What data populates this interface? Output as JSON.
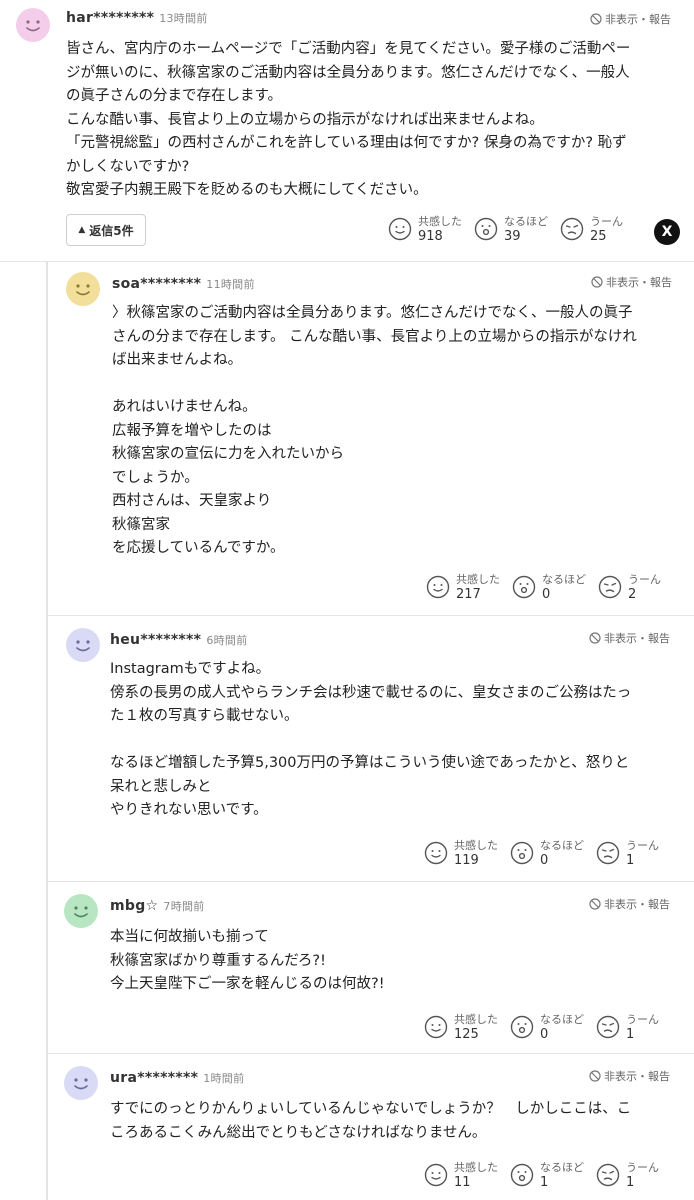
{
  "report_label": "非表示・報告",
  "reaction_labels": {
    "agree": "共感した",
    "understood": "なるほど",
    "hmm": "うーん"
  },
  "colors": {
    "avatar_pink": "#f4cdea",
    "avatar_yellow": "#f2df9a",
    "avatar_lavender": "#d9daf5",
    "avatar_green": "#b8e6c2"
  },
  "top_comment": {
    "author": "har********",
    "time": "13時間前",
    "body": "皆さん、宮内庁のホームページで「ご活動内容」を見てください。愛子様のご活動ペー\nジが無いのに、秋篠宮家のご活動内容は全員分あります。悠仁さんだけでなく、一般人\nの眞子さんの分まで存在します。\nこんな酷い事、長官より上の立場からの指示がなければ出来ませんよね。\n「元警視総監」の西村さんがこれを許している理由は何ですか? 保身の為ですか? 恥ず\nかしくないですか?\n敬宮愛子内親王殿下を貶めるのも大概にしてください。",
    "reply_button": "返信5件",
    "agree": "918",
    "understood": "39",
    "hmm": "25",
    "share_label": "X"
  },
  "replies": [
    {
      "author": "soa********",
      "time": "11時間前",
      "body": "〉秋篠宮家のご活動内容は全員分あります。悠仁さんだけでなく、一般人の眞子\nさんの分まで存在します。 こんな酷い事、長官より上の立場からの指示がなけれ\nば出来ませんよね。\n\nあれはいけませんね。\n広報予算を増やしたのは\n秋篠宮家の宣伝に力を入れたいから\nでしょうか。\n西村さんは、天皇家より\n秋篠宮家\nを応援しているんですか。",
      "agree": "217",
      "understood": "0",
      "hmm": "2"
    },
    {
      "author": "heu********",
      "time": "6時間前",
      "body": "Instagramもですよね。\n傍系の長男の成人式やらランチ会は秒速で載せるのに、皇女さまのご公務はたっ\nた１枚の写真すら載せない。\n\nなるほど増額した予算5,300万円の予算はこういう使い途であったかと、怒りと\n呆れと悲しみと\nやりきれない思いです。",
      "agree": "119",
      "understood": "0",
      "hmm": "1"
    },
    {
      "author": "mbg☆",
      "time": "7時間前",
      "body": "本当に何故揃いも揃って\n秋篠宮家ばかり尊重するんだろ?!\n今上天皇陛下ご一家を軽んじるのは何故?!",
      "agree": "125",
      "understood": "0",
      "hmm": "1"
    },
    {
      "author": "ura********",
      "time": "1時間前",
      "body": "すでにのっとりかんりょいしているんじゃないでしょうか？　しかしここは、こ\nころあるこくみん総出でとりもどさなければなりません。",
      "agree": "11",
      "understood": "1",
      "hmm": "1"
    }
  ]
}
